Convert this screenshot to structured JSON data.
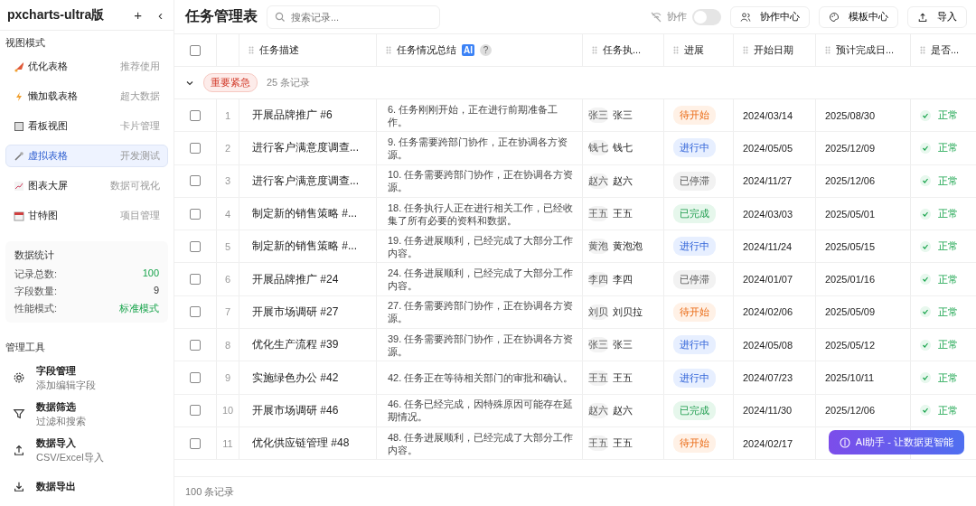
{
  "app": {
    "title": "pxcharts-ultra版",
    "add_icon": "+",
    "collapse_icon": "‹"
  },
  "views": {
    "heading": "视图模式",
    "items": [
      {
        "label": "优化表格",
        "hint": "推荐使用",
        "selected": false
      },
      {
        "label": "懒加载表格",
        "hint": "超大数据",
        "selected": false
      },
      {
        "label": "看板视图",
        "hint": "卡片管理",
        "selected": false
      },
      {
        "label": "虚拟表格",
        "hint": "开发测试",
        "selected": true
      },
      {
        "label": "图表大屏",
        "hint": "数据可视化",
        "selected": false
      },
      {
        "label": "甘特图",
        "hint": "项目管理",
        "selected": false
      }
    ]
  },
  "stats": {
    "heading": "数据统计",
    "items": [
      {
        "label": "记录总数:",
        "value": "100",
        "kind": "accent"
      },
      {
        "label": "字段数量:",
        "value": "9",
        "kind": "plain"
      },
      {
        "label": "性能模式:",
        "value": "标准模式",
        "kind": "accent"
      }
    ]
  },
  "tools": {
    "heading": "管理工具",
    "items": [
      {
        "title": "字段管理",
        "subtitle": "添加编辑字段"
      },
      {
        "title": "数据筛选",
        "subtitle": "过滤和搜索"
      },
      {
        "title": "数据导入",
        "subtitle": "CSV/Excel导入"
      },
      {
        "title": "数据导出"
      }
    ]
  },
  "toolbar": {
    "title": "任务管理表",
    "search": {
      "placeholder": "搜索记录..."
    },
    "collab": {
      "label": "协作",
      "on": false
    },
    "buttons": [
      {
        "label": "协作中心"
      },
      {
        "label": "模板中心"
      },
      {
        "label": "导入"
      }
    ]
  },
  "table": {
    "select_all": false,
    "columns": [
      {
        "label": "任务描述"
      },
      {
        "label": "任务情况总结",
        "ai_badge": "AI",
        "help": "?"
      },
      {
        "label": "任务执..."
      },
      {
        "label": "进展"
      },
      {
        "label": "开始日期"
      },
      {
        "label": "预计完成日..."
      },
      {
        "label": "是否..."
      }
    ],
    "group": {
      "expanded": true,
      "tag": "重要紧急",
      "count": "25 条记录"
    },
    "rows": [
      {
        "index": "1",
        "checked": false,
        "title": "开展品牌推广 #6",
        "summary": "6. 任务刚刚开始，正在进行前期准备工作。",
        "avatar": "张三",
        "owner": "张三",
        "status": {
          "label": "待开始",
          "kind": "pending"
        },
        "start": "2024/03/14",
        "end": "2025/08/30",
        "health": {
          "label": "正常",
          "kind": "ok"
        }
      },
      {
        "index": "2",
        "checked": false,
        "title": "进行客户满意度调查...",
        "summary": "9. 任务需要跨部门协作，正在协调各方资源。",
        "avatar": "钱七",
        "owner": "钱七",
        "status": {
          "label": "进行中",
          "kind": "active"
        },
        "start": "2024/05/05",
        "end": "2025/12/09",
        "health": {
          "label": "正常",
          "kind": "ok"
        }
      },
      {
        "index": "3",
        "checked": false,
        "title": "进行客户满意度调查...",
        "summary": "10. 任务需要跨部门协作，正在协调各方资源。",
        "avatar": "赵六",
        "owner": "赵六",
        "status": {
          "label": "已停滞",
          "kind": "stalled"
        },
        "start": "2024/11/27",
        "end": "2025/12/06",
        "health": {
          "label": "正常",
          "kind": "ok"
        }
      },
      {
        "index": "4",
        "checked": false,
        "title": "制定新的销售策略 #...",
        "summary": "18. 任务执行人正在进行相关工作，已经收集了所有必要的资料和数据。",
        "avatar": "王五",
        "owner": "王五",
        "status": {
          "label": "已完成",
          "kind": "done"
        },
        "start": "2024/03/03",
        "end": "2025/05/01",
        "health": {
          "label": "正常",
          "kind": "ok"
        }
      },
      {
        "index": "5",
        "checked": false,
        "title": "制定新的销售策略 #...",
        "summary": "19. 任务进展顺利，已经完成了大部分工作内容。",
        "avatar": "黄泡",
        "owner": "黄泡泡",
        "status": {
          "label": "进行中",
          "kind": "active"
        },
        "start": "2024/11/24",
        "end": "2025/05/15",
        "health": {
          "label": "正常",
          "kind": "ok"
        }
      },
      {
        "index": "6",
        "checked": false,
        "title": "开展品牌推广 #24",
        "summary": "24. 任务进展顺利，已经完成了大部分工作内容。",
        "avatar": "李四",
        "owner": "李四",
        "status": {
          "label": "已停滞",
          "kind": "stalled"
        },
        "start": "2024/01/07",
        "end": "2025/01/16",
        "health": {
          "label": "正常",
          "kind": "ok"
        }
      },
      {
        "index": "7",
        "checked": false,
        "title": "开展市场调研 #27",
        "summary": "27. 任务需要跨部门协作，正在协调各方资源。",
        "avatar": "刘贝",
        "owner": "刘贝拉",
        "status": {
          "label": "待开始",
          "kind": "pending"
        },
        "start": "2024/02/06",
        "end": "2025/05/09",
        "health": {
          "label": "正常",
          "kind": "ok"
        }
      },
      {
        "index": "8",
        "checked": false,
        "title": "优化生产流程 #39",
        "summary": "39. 任务需要跨部门协作，正在协调各方资源。",
        "avatar": "张三",
        "owner": "张三",
        "status": {
          "label": "进行中",
          "kind": "active"
        },
        "start": "2024/05/08",
        "end": "2025/05/12",
        "health": {
          "label": "正常",
          "kind": "ok"
        }
      },
      {
        "index": "9",
        "checked": false,
        "title": "实施绿色办公 #42",
        "summary": "42. 任务正在等待相关部门的审批和确认。",
        "avatar": "王五",
        "owner": "王五",
        "status": {
          "label": "进行中",
          "kind": "active"
        },
        "start": "2024/07/23",
        "end": "2025/10/11",
        "health": {
          "label": "正常",
          "kind": "ok"
        }
      },
      {
        "index": "10",
        "checked": false,
        "title": "开展市场调研 #46",
        "summary": "46. 任务已经完成，因特殊原因可能存在延期情况。",
        "avatar": "赵六",
        "owner": "赵六",
        "status": {
          "label": "已完成",
          "kind": "done"
        },
        "start": "2024/11/30",
        "end": "2025/12/06",
        "health": {
          "label": "正常",
          "kind": "ok"
        }
      },
      {
        "index": "11",
        "checked": false,
        "title": "优化供应链管理 #48",
        "summary": "48. 任务进展顺利，已经完成了大部分工作内容。",
        "avatar": "王五",
        "owner": "王五",
        "status": {
          "label": "待开始",
          "kind": "pending"
        },
        "start": "2024/02/17"
      }
    ],
    "footer": "100 条记录"
  },
  "assistant": {
    "label": "AI助手 - 让数据更智能"
  }
}
